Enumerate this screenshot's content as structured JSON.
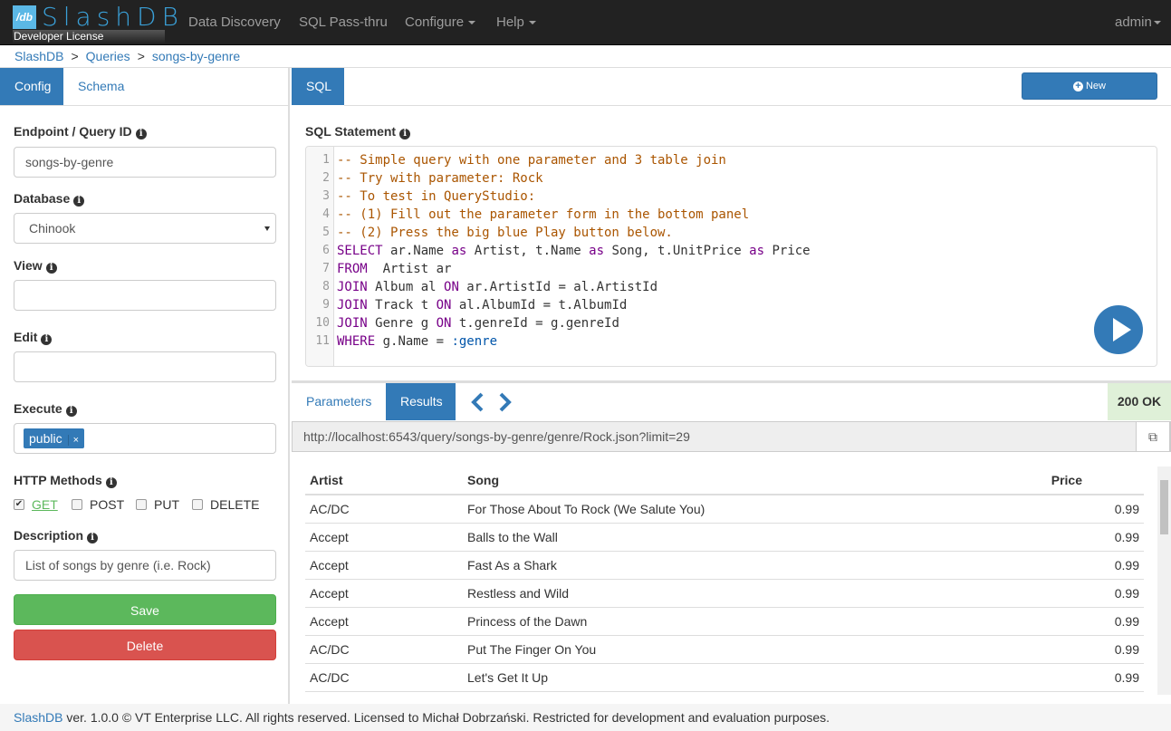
{
  "navbar": {
    "logo_text": "SlashDB",
    "logo_mark": "/db",
    "license": "Developer License",
    "items": [
      "Data Discovery",
      "SQL Pass-thru",
      "Configure",
      "Help"
    ],
    "user": "admin"
  },
  "breadcrumb": [
    "SlashDB",
    "Queries",
    "songs-by-genre"
  ],
  "left": {
    "tabs": [
      "Config",
      "Schema"
    ],
    "endpoint": {
      "label": "Endpoint / Query ID",
      "value": "songs-by-genre"
    },
    "database": {
      "label": "Database",
      "value": "Chinook"
    },
    "view": {
      "label": "View",
      "value": ""
    },
    "edit": {
      "label": "Edit",
      "value": ""
    },
    "execute": {
      "label": "Execute",
      "chip": "public",
      "remove": "×"
    },
    "http": {
      "label": "HTTP Methods",
      "methods": [
        {
          "name": "GET",
          "checked": true
        },
        {
          "name": "POST",
          "checked": false
        },
        {
          "name": "PUT",
          "checked": false
        },
        {
          "name": "DELETE",
          "checked": false
        }
      ]
    },
    "description": {
      "label": "Description",
      "value": "List of songs by genre (i.e. Rock)"
    },
    "save": "Save",
    "delete": "Delete"
  },
  "right": {
    "tab": "SQL",
    "new_label": "New",
    "sql_label": "SQL Statement",
    "code": [
      [
        [
          "c",
          "-- Simple query with one parameter and 3 table join"
        ]
      ],
      [
        [
          "c",
          "-- Try with parameter: Rock"
        ]
      ],
      [
        [
          "c",
          "-- To test in QueryStudio:"
        ]
      ],
      [
        [
          "c",
          "-- (1) Fill out the parameter form in the bottom panel"
        ]
      ],
      [
        [
          "c",
          "-- (2) Press the big blue Play button below."
        ]
      ],
      [
        [
          "k",
          "SELECT"
        ],
        [
          "t",
          " ar.Name "
        ],
        [
          "k",
          "as"
        ],
        [
          "t",
          " Artist, t.Name "
        ],
        [
          "k",
          "as"
        ],
        [
          "t",
          " Song, t.UnitPrice "
        ],
        [
          "k",
          "as"
        ],
        [
          "t",
          " Price"
        ]
      ],
      [
        [
          "k",
          "FROM"
        ],
        [
          "t",
          "  Artist ar"
        ]
      ],
      [
        [
          "k",
          "JOIN"
        ],
        [
          "t",
          " Album al "
        ],
        [
          "k",
          "ON"
        ],
        [
          "t",
          " ar.ArtistId = al.ArtistId"
        ]
      ],
      [
        [
          "k",
          "JOIN"
        ],
        [
          "t",
          " Track t "
        ],
        [
          "k",
          "ON"
        ],
        [
          "t",
          " al.AlbumId = t.AlbumId"
        ]
      ],
      [
        [
          "k",
          "JOIN"
        ],
        [
          "t",
          " Genre g "
        ],
        [
          "k",
          "ON"
        ],
        [
          "t",
          " t.genreId = g.genreId"
        ]
      ],
      [
        [
          "k",
          "WHERE"
        ],
        [
          "t",
          " g.Name = "
        ],
        [
          "v",
          ":genre"
        ]
      ]
    ],
    "bottom_tabs": [
      "Parameters",
      "Results"
    ],
    "status": "200 OK",
    "url": "http://localhost:6543/query/songs-by-genre/genre/Rock.json?limit=29",
    "table": {
      "headers": [
        "Artist",
        "Song",
        "Price"
      ],
      "rows": [
        [
          "AC/DC",
          "For Those About To Rock (We Salute You)",
          "0.99"
        ],
        [
          "Accept",
          "Balls to the Wall",
          "0.99"
        ],
        [
          "Accept",
          "Fast As a Shark",
          "0.99"
        ],
        [
          "Accept",
          "Restless and Wild",
          "0.99"
        ],
        [
          "Accept",
          "Princess of the Dawn",
          "0.99"
        ],
        [
          "AC/DC",
          "Put The Finger On You",
          "0.99"
        ],
        [
          "AC/DC",
          "Let's Get It Up",
          "0.99"
        ]
      ]
    }
  },
  "footer": {
    "brand": "SlashDB",
    "text": " ver. 1.0.0 © VT Enterprise LLC. All rights reserved. Licensed to Michał Dobrzański. Restricted for development and evaluation purposes."
  },
  "colors": {
    "primary": "#337ab7",
    "success": "#5cb85c",
    "danger": "#d9534f",
    "comment": "#aa5500",
    "keyword": "#770088",
    "variable": "#0055aa"
  }
}
